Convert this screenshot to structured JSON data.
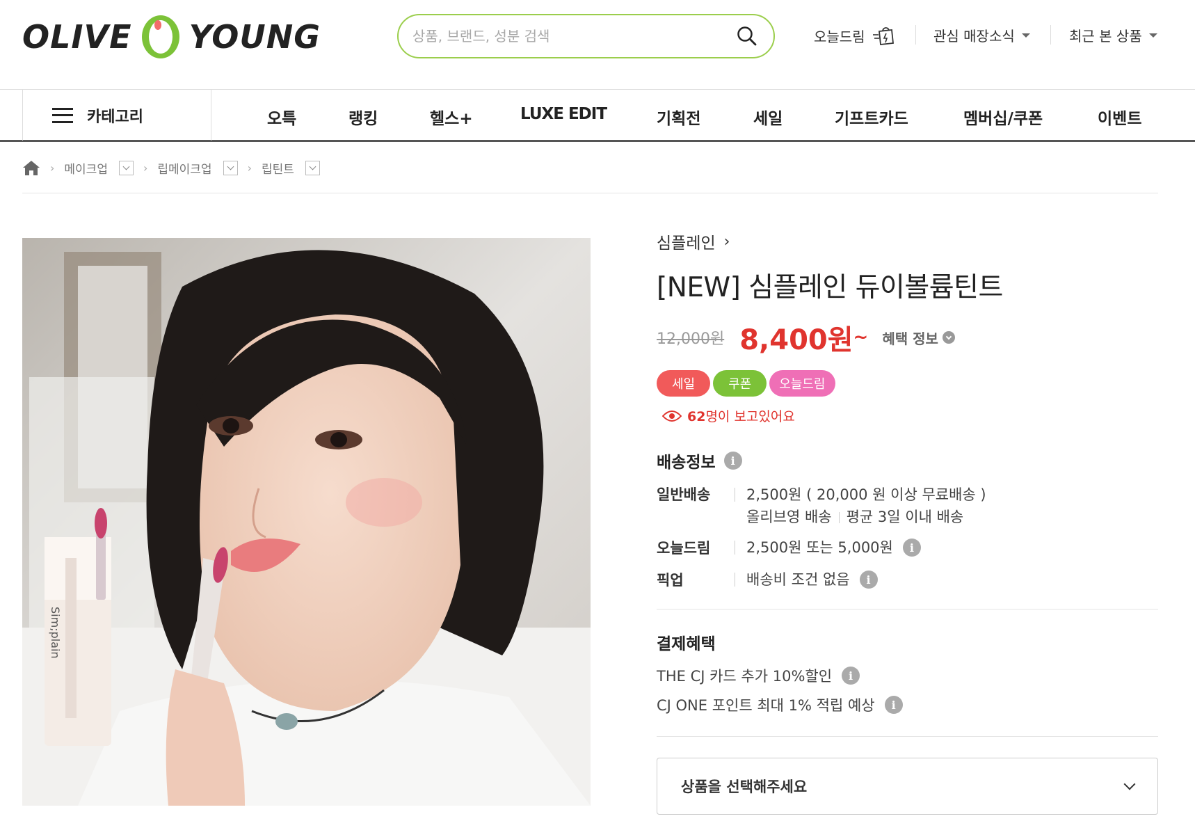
{
  "header": {
    "logo_left": "OLIVE",
    "logo_right": "YOUNG",
    "search_placeholder": "상품, 브랜드, 성분 검색",
    "util": {
      "today_dream": "오늘드림",
      "store_news": "관심 매장소식",
      "recent": "최근 본 상품"
    }
  },
  "gnb": {
    "category": "카테고리",
    "items": [
      "오특",
      "랭킹",
      "헬스+",
      "LUXE EDIT",
      "기획전",
      "세일",
      "기프트카드",
      "멤버십/쿠폰",
      "이벤트"
    ]
  },
  "breadcrumb": [
    "메이크업",
    "립메이크업",
    "립틴트"
  ],
  "product": {
    "brand": "심플레인",
    "name": "[NEW] 심플레인 듀이볼륨틴트",
    "price_original": "12,000원",
    "price_sale": "8,400원",
    "price_tilde": "~",
    "benefit_label": "혜택 정보",
    "flags": [
      {
        "label": "세일",
        "color": "#f15a5a"
      },
      {
        "label": "쿠폰",
        "color": "#7cc238"
      },
      {
        "label": "오늘드림",
        "color": "#ef6fb6"
      }
    ],
    "viewers_count": "62",
    "viewers_suffix": "명이 보고있어요",
    "tube_text": "Sim;plain"
  },
  "delivery": {
    "title": "배송정보",
    "rows": [
      {
        "label": "일반배송",
        "line1": "2,500원 ( 20,000 원 이상 무료배송 )",
        "line2a": "올리브영 배송",
        "line2b": "평균 3일 이내 배송"
      },
      {
        "label": "오늘드림",
        "line1": "2,500원 또는 5,000원"
      },
      {
        "label": "픽업",
        "line1": "배송비 조건 없음"
      }
    ]
  },
  "payment": {
    "title": "결제혜택",
    "items": [
      "THE CJ 카드 추가 10%할인",
      "CJ ONE 포인트 최대 1% 적립 예상"
    ]
  },
  "select_label": "상품을 선택해주세요",
  "colors": {
    "brand_green": "#9bce4c",
    "price_red": "#e0342e"
  }
}
